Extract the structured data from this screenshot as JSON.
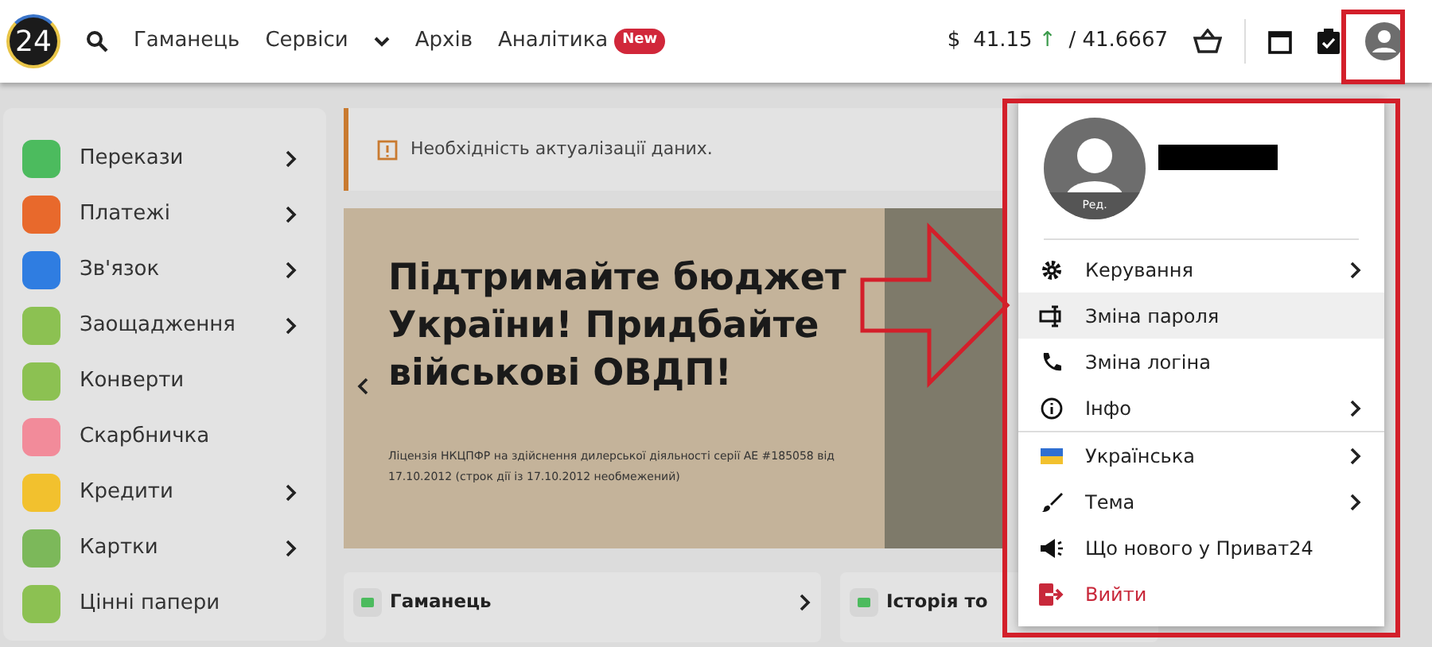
{
  "header": {
    "logo": "24",
    "nav": [
      {
        "label": "Гаманець",
        "dropdown": false
      },
      {
        "label": "Сервіси",
        "dropdown": true
      },
      {
        "label": "Архів",
        "dropdown": false
      },
      {
        "label": "Аналітика",
        "dropdown": false,
        "badge": "New"
      }
    ],
    "currency": {
      "symbol": "$",
      "buy": "41.15",
      "trend": "↑",
      "sell": "/ 41.6667"
    }
  },
  "sidebar": {
    "items": [
      {
        "label": "Перекази",
        "color": "#4cbb5e",
        "submenu": true
      },
      {
        "label": "Платежі",
        "color": "#e8692c",
        "submenu": true
      },
      {
        "label": "Зв'язок",
        "color": "#2f7de1",
        "submenu": true
      },
      {
        "label": "Заощадження",
        "color": "#8cc152",
        "submenu": true
      },
      {
        "label": "Конверти",
        "color": "#8cc152",
        "submenu": false
      },
      {
        "label": "Скарбничка",
        "color": "#f28b9a",
        "submenu": false
      },
      {
        "label": "Кредити",
        "color": "#f2c12e",
        "submenu": true
      },
      {
        "label": "Картки",
        "color": "#7cb85a",
        "submenu": true
      },
      {
        "label": "Цінні папери",
        "color": "#8cc152",
        "submenu": false
      }
    ]
  },
  "alert": {
    "text": "Необхідність актуалізації даних."
  },
  "banner": {
    "title": "Підтримайте бюджет України! Придбайте військові ОВДП!",
    "license": "Ліцензія НКЦПФР на здійснення дилерської діяльності серії АЕ #185058 від 17.10.2012 (строк дії із 17.10.2012 необмежений)"
  },
  "cards": [
    {
      "title": "Гаманець",
      "chevron": true
    },
    {
      "title": "Історія то"
    }
  ],
  "profile_menu": {
    "avatar_label": "Ред.",
    "groups": [
      [
        {
          "label": "Керування",
          "submenu": true,
          "selected": false,
          "kind": "normal"
        },
        {
          "label": "Зміна пароля",
          "submenu": false,
          "selected": true,
          "kind": "normal"
        },
        {
          "label": "Зміна логіна",
          "submenu": false,
          "selected": false,
          "kind": "normal"
        },
        {
          "label": "Інфо",
          "submenu": true,
          "selected": false,
          "kind": "normal"
        }
      ],
      [
        {
          "label": "Українська",
          "submenu": true,
          "selected": false,
          "kind": "normal"
        },
        {
          "label": "Тема",
          "submenu": true,
          "selected": false,
          "kind": "normal"
        },
        {
          "label": "Що нового у Приват24",
          "submenu": false,
          "selected": false,
          "kind": "normal"
        },
        {
          "label": "Вийти",
          "submenu": false,
          "selected": false,
          "kind": "logout"
        }
      ]
    ]
  }
}
